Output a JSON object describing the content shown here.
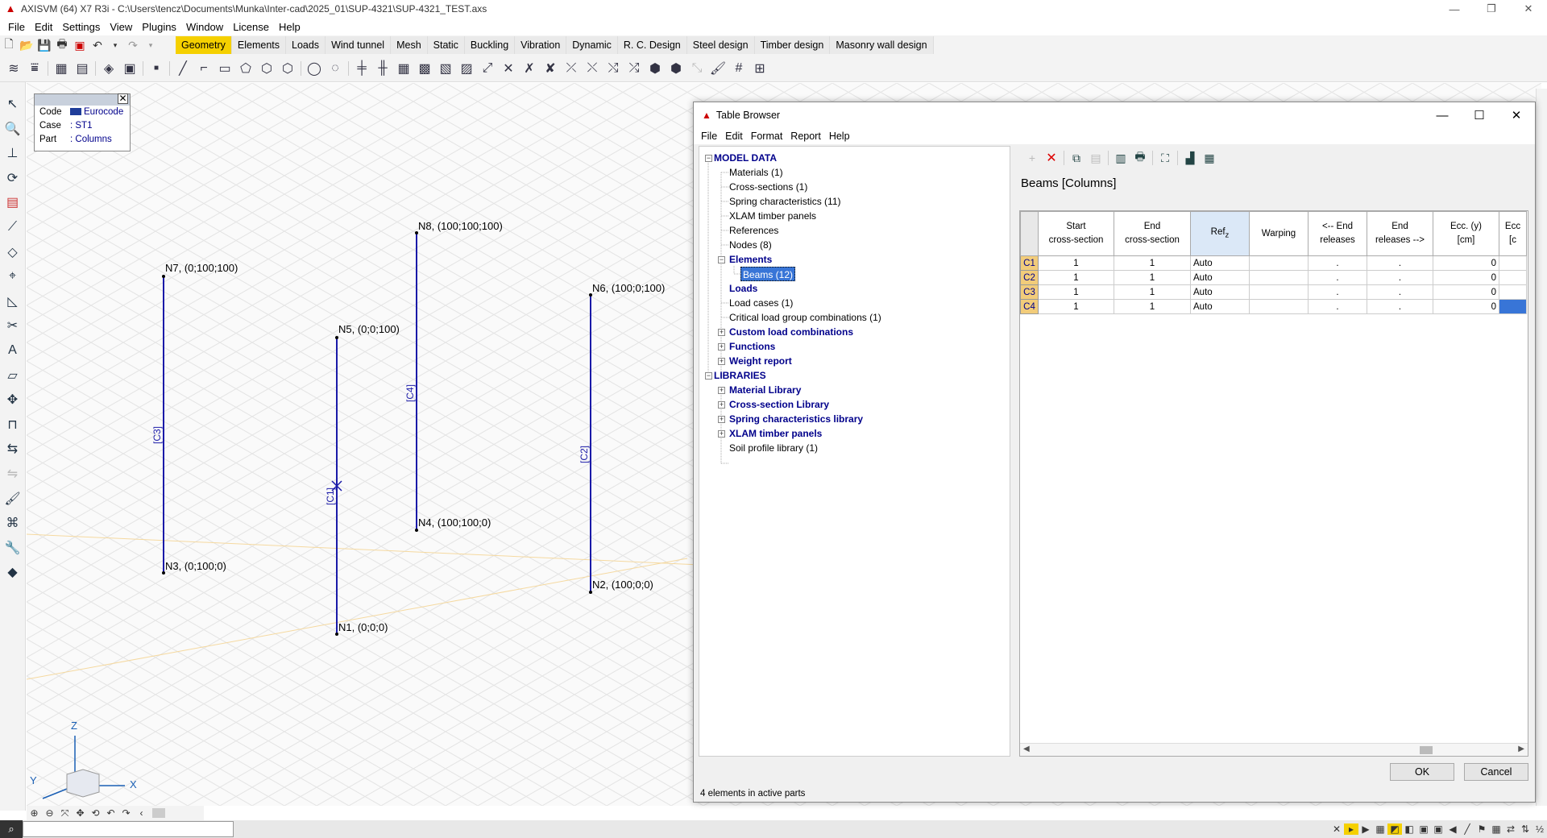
{
  "app": {
    "title": "AXISVM (64) X7 R3i - C:\\Users\\tencz\\Documents\\Munka\\Inter-cad\\2025_01\\SUP-4321\\SUP-4321_TEST.axs",
    "window_buttons": [
      "—",
      "❐",
      "✕"
    ]
  },
  "menu": [
    "File",
    "Edit",
    "Settings",
    "View",
    "Plugins",
    "Window",
    "License",
    "Help"
  ],
  "ribbon_tabs": [
    {
      "label": "Geometry",
      "active": true
    },
    {
      "label": "Elements"
    },
    {
      "label": "Loads"
    },
    {
      "label": "Wind tunnel"
    },
    {
      "label": "Mesh"
    },
    {
      "label": "Static"
    },
    {
      "label": "Buckling"
    },
    {
      "label": "Vibration"
    },
    {
      "label": "Dynamic"
    },
    {
      "label": "R. C. Design"
    },
    {
      "label": "Steel design"
    },
    {
      "label": "Timber design"
    },
    {
      "label": "Masonry wall design"
    }
  ],
  "infobox": {
    "rows": [
      {
        "key": "Code",
        "value": "Eurocode"
      },
      {
        "key": "Case",
        "value": ": ST1"
      },
      {
        "key": "Part",
        "value": ": Columns"
      }
    ]
  },
  "viewport": {
    "nodes": [
      "N7, (0;100;100)",
      "N8, (100;100;100)",
      "N5, (0;0;100)",
      "N6, (100;0;100)",
      "N4, (100;100;0)",
      "N3, (0;100;0)",
      "N2, (100;0;0)",
      "N1, (0;0;0)"
    ],
    "beams": [
      "[C3]",
      "[C4]",
      "[C1]",
      "[C2]"
    ],
    "axes": {
      "z": "Z",
      "x": "X",
      "y": "Y"
    }
  },
  "statusbar": {
    "search_placeholder": ""
  },
  "dialog": {
    "title": "Table Browser",
    "menu": [
      "File",
      "Edit",
      "Format",
      "Report",
      "Help"
    ],
    "tree": {
      "model_data": "MODEL DATA",
      "materials": "Materials (1)",
      "cross_sections": "Cross-sections (1)",
      "spring_characteristics": "Spring characteristics (11)",
      "xlam": "XLAM timber panels",
      "references": "References",
      "nodes": "Nodes (8)",
      "elements": "Elements",
      "beams": "Beams (12)",
      "loads": "Loads",
      "load_cases": "Load cases (1)",
      "critical": "Critical load group combinations (1)",
      "custom": "Custom load combinations",
      "functions": "Functions",
      "weight": "Weight report",
      "libraries": "LIBRARIES",
      "material_library": "Material Library",
      "cs_library": "Cross-section Library",
      "spring_library": "Spring characteristics library",
      "xlam_library": "XLAM timber panels",
      "soil": "Soil profile library (1)"
    },
    "table_title": "Beams [Columns]",
    "columns": [
      {
        "line1": "Start",
        "line2": "cross-section"
      },
      {
        "line1": "End",
        "line2": "cross-section"
      },
      {
        "line1": "Ref",
        "line2": "z"
      },
      {
        "line1": "Warping",
        "line2": ""
      },
      {
        "line1": "<-- End",
        "line2": "releases"
      },
      {
        "line1": "End",
        "line2": "releases -->"
      },
      {
        "line1": "Ecc. (y)",
        "line2": "[cm]"
      },
      {
        "line1": "Ecc",
        "line2": "[c"
      }
    ],
    "rows": [
      {
        "id": "C1",
        "start": "1",
        "end": "1",
        "ref": "Auto",
        "warping": "",
        "rel1": ".",
        "rel2": ".",
        "eccy": "0"
      },
      {
        "id": "C2",
        "start": "1",
        "end": "1",
        "ref": "Auto",
        "warping": "",
        "rel1": ".",
        "rel2": ".",
        "eccy": "0"
      },
      {
        "id": "C3",
        "start": "1",
        "end": "1",
        "ref": "Auto",
        "warping": "",
        "rel1": ".",
        "rel2": ".",
        "eccy": "0"
      },
      {
        "id": "C4",
        "start": "1",
        "end": "1",
        "ref": "Auto",
        "warping": "",
        "rel1": ".",
        "rel2": ".",
        "eccy": "0"
      }
    ],
    "ok_label": "OK",
    "cancel_label": "Cancel",
    "status": "4 elements in active parts"
  },
  "colors": {
    "accent": "#f5d000",
    "beam": "#1a1aa8",
    "selection": "#3875d7",
    "rowheader": "#f2cc7a"
  }
}
